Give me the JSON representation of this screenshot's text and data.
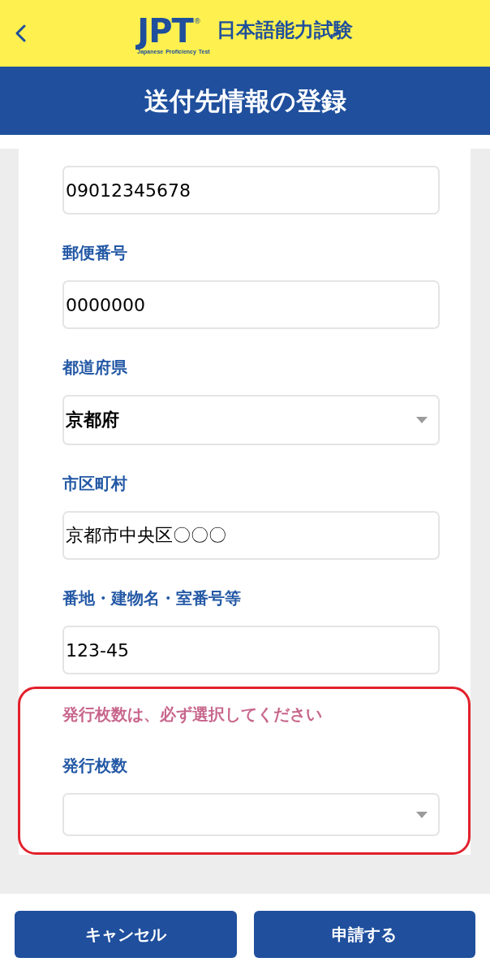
{
  "header": {
    "logo": {
      "mark": "JPT",
      "registered": "®",
      "tagline": "Japanese Proficiency Test",
      "name": "日本語能力試験"
    }
  },
  "title_bar": {
    "title": "送付先情報の登録"
  },
  "form": {
    "fields": [
      {
        "kind": "text",
        "value": "09012345678",
        "highlighted": false
      },
      {
        "kind": "text",
        "label": "郵便番号",
        "value": "0000000",
        "highlighted": false
      },
      {
        "kind": "select",
        "label": "都道府県",
        "value": "京都府",
        "highlighted": false
      },
      {
        "kind": "text",
        "label": "市区町村",
        "value": "京都市中央区〇〇〇",
        "highlighted": false
      },
      {
        "kind": "text",
        "label": "番地・建物名・室番号等",
        "value": "123-45",
        "highlighted": false
      },
      {
        "kind": "select",
        "label": "発行枚数",
        "error": "発行枚数は、必ず選択してください",
        "highlighted": true
      }
    ]
  },
  "footer": {
    "buttons": [
      {
        "label": "キャンセル"
      },
      {
        "label": "申請する"
      }
    ]
  }
}
